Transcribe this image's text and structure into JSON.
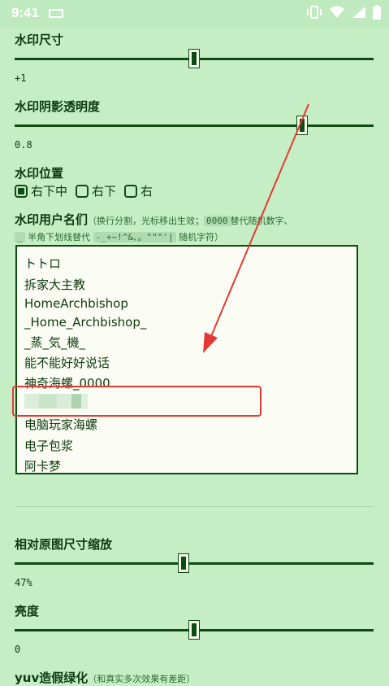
{
  "status_bar": {
    "time": "9:41",
    "icons": [
      "keyboard-icon",
      "vibrate-icon",
      "wifi-icon",
      "signal-icon",
      "battery-icon"
    ]
  },
  "watermark_size": {
    "label": "水印尺寸",
    "value_text": "+1",
    "fraction": 0.5
  },
  "shadow_opacity": {
    "label": "水印阴影透明度",
    "value_text": "0.8",
    "fraction": 0.8
  },
  "position": {
    "label": "水印位置",
    "options": [
      {
        "label": "右下中",
        "checked": true
      },
      {
        "label": "右下",
        "checked": false
      },
      {
        "label": "右",
        "checked": false
      }
    ]
  },
  "usernames": {
    "label": "水印用户名们",
    "hint_1_prefix": "（换行分割，光标移出生效；",
    "hint_1_code": "0000",
    "hint_1_suffix": "替代随机数字、",
    "hint_2_code1": "_",
    "hint_2_text": "半角下划线替代",
    "hint_2_code2": "-_+~!^&、。\"\"\"'|",
    "hint_2_suffix": "随机字符）",
    "lines": [
      "トトロ",
      "拆家大主教",
      "HomeArchbishop",
      "_Home_Archbishop_",
      "_蒸_気_機_",
      "能不能好好说话",
      "神奇海螺_0000",
      "",
      "电脑玩家海螺",
      "电子包浆",
      "阿卡梦"
    ]
  },
  "scale": {
    "label": "相对原图尺寸缩放",
    "value_text": "47%",
    "fraction": 0.47
  },
  "brightness": {
    "label": "亮度",
    "value_text": "0",
    "fraction": 0.5
  },
  "yuv": {
    "label": "yuv造假绿化",
    "hint": "（和真实多次效果有差距）"
  },
  "colors": {
    "background": "#c5eec5",
    "accent": "#0f4a14",
    "annotation": "#e53935"
  }
}
